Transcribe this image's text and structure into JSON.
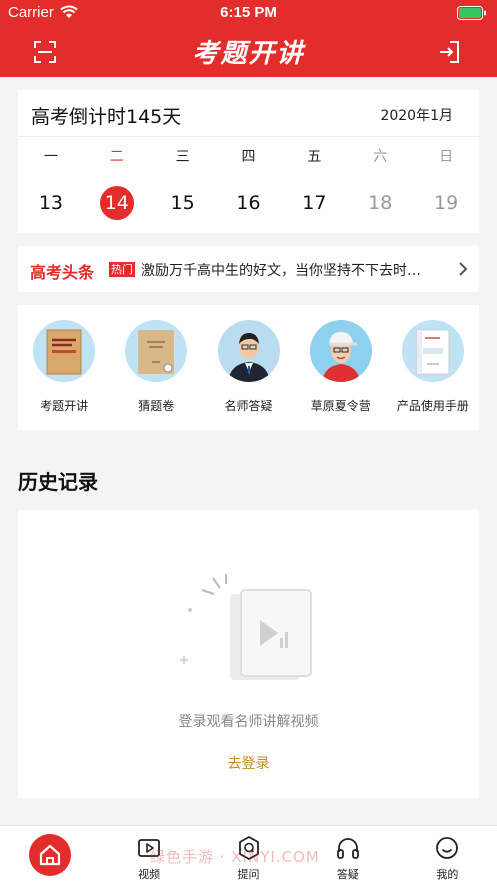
{
  "status_bar": {
    "carrier": "Carrier",
    "time": "6:15 PM"
  },
  "nav": {
    "logo": "考题开讲"
  },
  "calendar": {
    "countdown": "高考倒计时145天",
    "month": "2020年1月",
    "weekdays": [
      "一",
      "二",
      "三",
      "四",
      "五",
      "六",
      "日"
    ],
    "days": [
      "13",
      "14",
      "15",
      "16",
      "17",
      "18",
      "19"
    ]
  },
  "headline": {
    "label": "高考头条",
    "tag": "热门",
    "text": "激励万千高中生的好文，当你坚持不下去时…"
  },
  "entries": [
    {
      "label": "考题开讲",
      "icon": "book-cover-icon"
    },
    {
      "label": "猜题卷",
      "icon": "exam-paper-icon"
    },
    {
      "label": "名师答疑",
      "icon": "teacher-avatar-icon"
    },
    {
      "label": "草原夏令营",
      "icon": "camp-avatar-icon"
    },
    {
      "label": "产品使用手册",
      "icon": "manual-icon"
    }
  ],
  "history": {
    "title": "历史记录",
    "empty_text": "登录观看名师讲解视频",
    "login_label": "去登录"
  },
  "tabbar": {
    "items": [
      {
        "label": "",
        "icon": "home-icon"
      },
      {
        "label": "视频",
        "icon": "video-icon"
      },
      {
        "label": "提问",
        "icon": "question-icon"
      },
      {
        "label": "答疑",
        "icon": "headphones-icon"
      },
      {
        "label": "我的",
        "icon": "profile-icon"
      }
    ]
  },
  "watermark": "绿色手游 · XINYI.COM",
  "colors": {
    "brand_red": "#e32c2c",
    "link_gold": "#c98a1e"
  }
}
